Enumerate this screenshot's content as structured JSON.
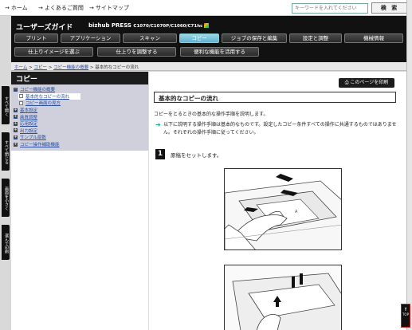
{
  "top_links": [
    {
      "arrow": "→",
      "label": "ホーム"
    },
    {
      "arrow": "→",
      "label": "よくあるご質問"
    },
    {
      "arrow": "→",
      "label": "サイトマップ"
    }
  ],
  "search": {
    "placeholder": "キーワードを入れてください",
    "button_label": "検 索"
  },
  "header": {
    "brand": "ユーザーズガイド",
    "model_main": "bizhub PRESS",
    "model_sub": "C1070/C1070P/C1060/C71hc"
  },
  "nav_row1": [
    "プリント",
    "アプリケーション",
    "スキャン",
    "コピー",
    "ジョブの保存と編集",
    "設定と調整",
    "機械情報"
  ],
  "nav_row2": [
    "仕上りイメージを選ぶ",
    "仕上りを調整する",
    "便利な機能を活用する"
  ],
  "active_nav": "コピー",
  "breadcrumb": {
    "home": "ホーム",
    "sep": ">",
    "copy": "コピー",
    "overview": "コピー機能の概要",
    "current": "基本的なコピーの流れ"
  },
  "side_tabs": [
    "すべて開く",
    "すべて閉じる",
    "画面を小さく",
    "選んで印刷"
  ],
  "left_panel": {
    "title": "コピー",
    "items": [
      {
        "label": "コピー機能の概要",
        "type": "open"
      },
      {
        "label": "基本的なコピーの流れ",
        "type": "sub-selected"
      },
      {
        "label": "コピー画面の見方",
        "type": "sub"
      },
      {
        "label": "基本設定",
        "type": "closed"
      },
      {
        "label": "画質調整",
        "type": "closed"
      },
      {
        "label": "応用設定",
        "type": "closed"
      },
      {
        "label": "出力設定",
        "type": "closed"
      },
      {
        "label": "サンプル部数",
        "type": "closed"
      },
      {
        "label": "コピー操作補助機能",
        "type": "closed"
      }
    ]
  },
  "main": {
    "print_button": "このページを印刷",
    "title": "基本的なコピーの流れ",
    "intro": "コピーをとるときの基本的な操作手順を説明します。",
    "note": "以下に説明する操作手順は基本的なものです。設定したコピー条件すべての操作に共通するものではありません。それぞれの操作手順に従ってください。",
    "step_number": "1",
    "step_text": "原稿をセットします。"
  },
  "top_button": "TOP",
  "colors": {
    "header_bg": "#111111",
    "active_tab": "#6cc0dc",
    "link": "#2a4fa0",
    "note_arrow": "#1aa89a"
  }
}
